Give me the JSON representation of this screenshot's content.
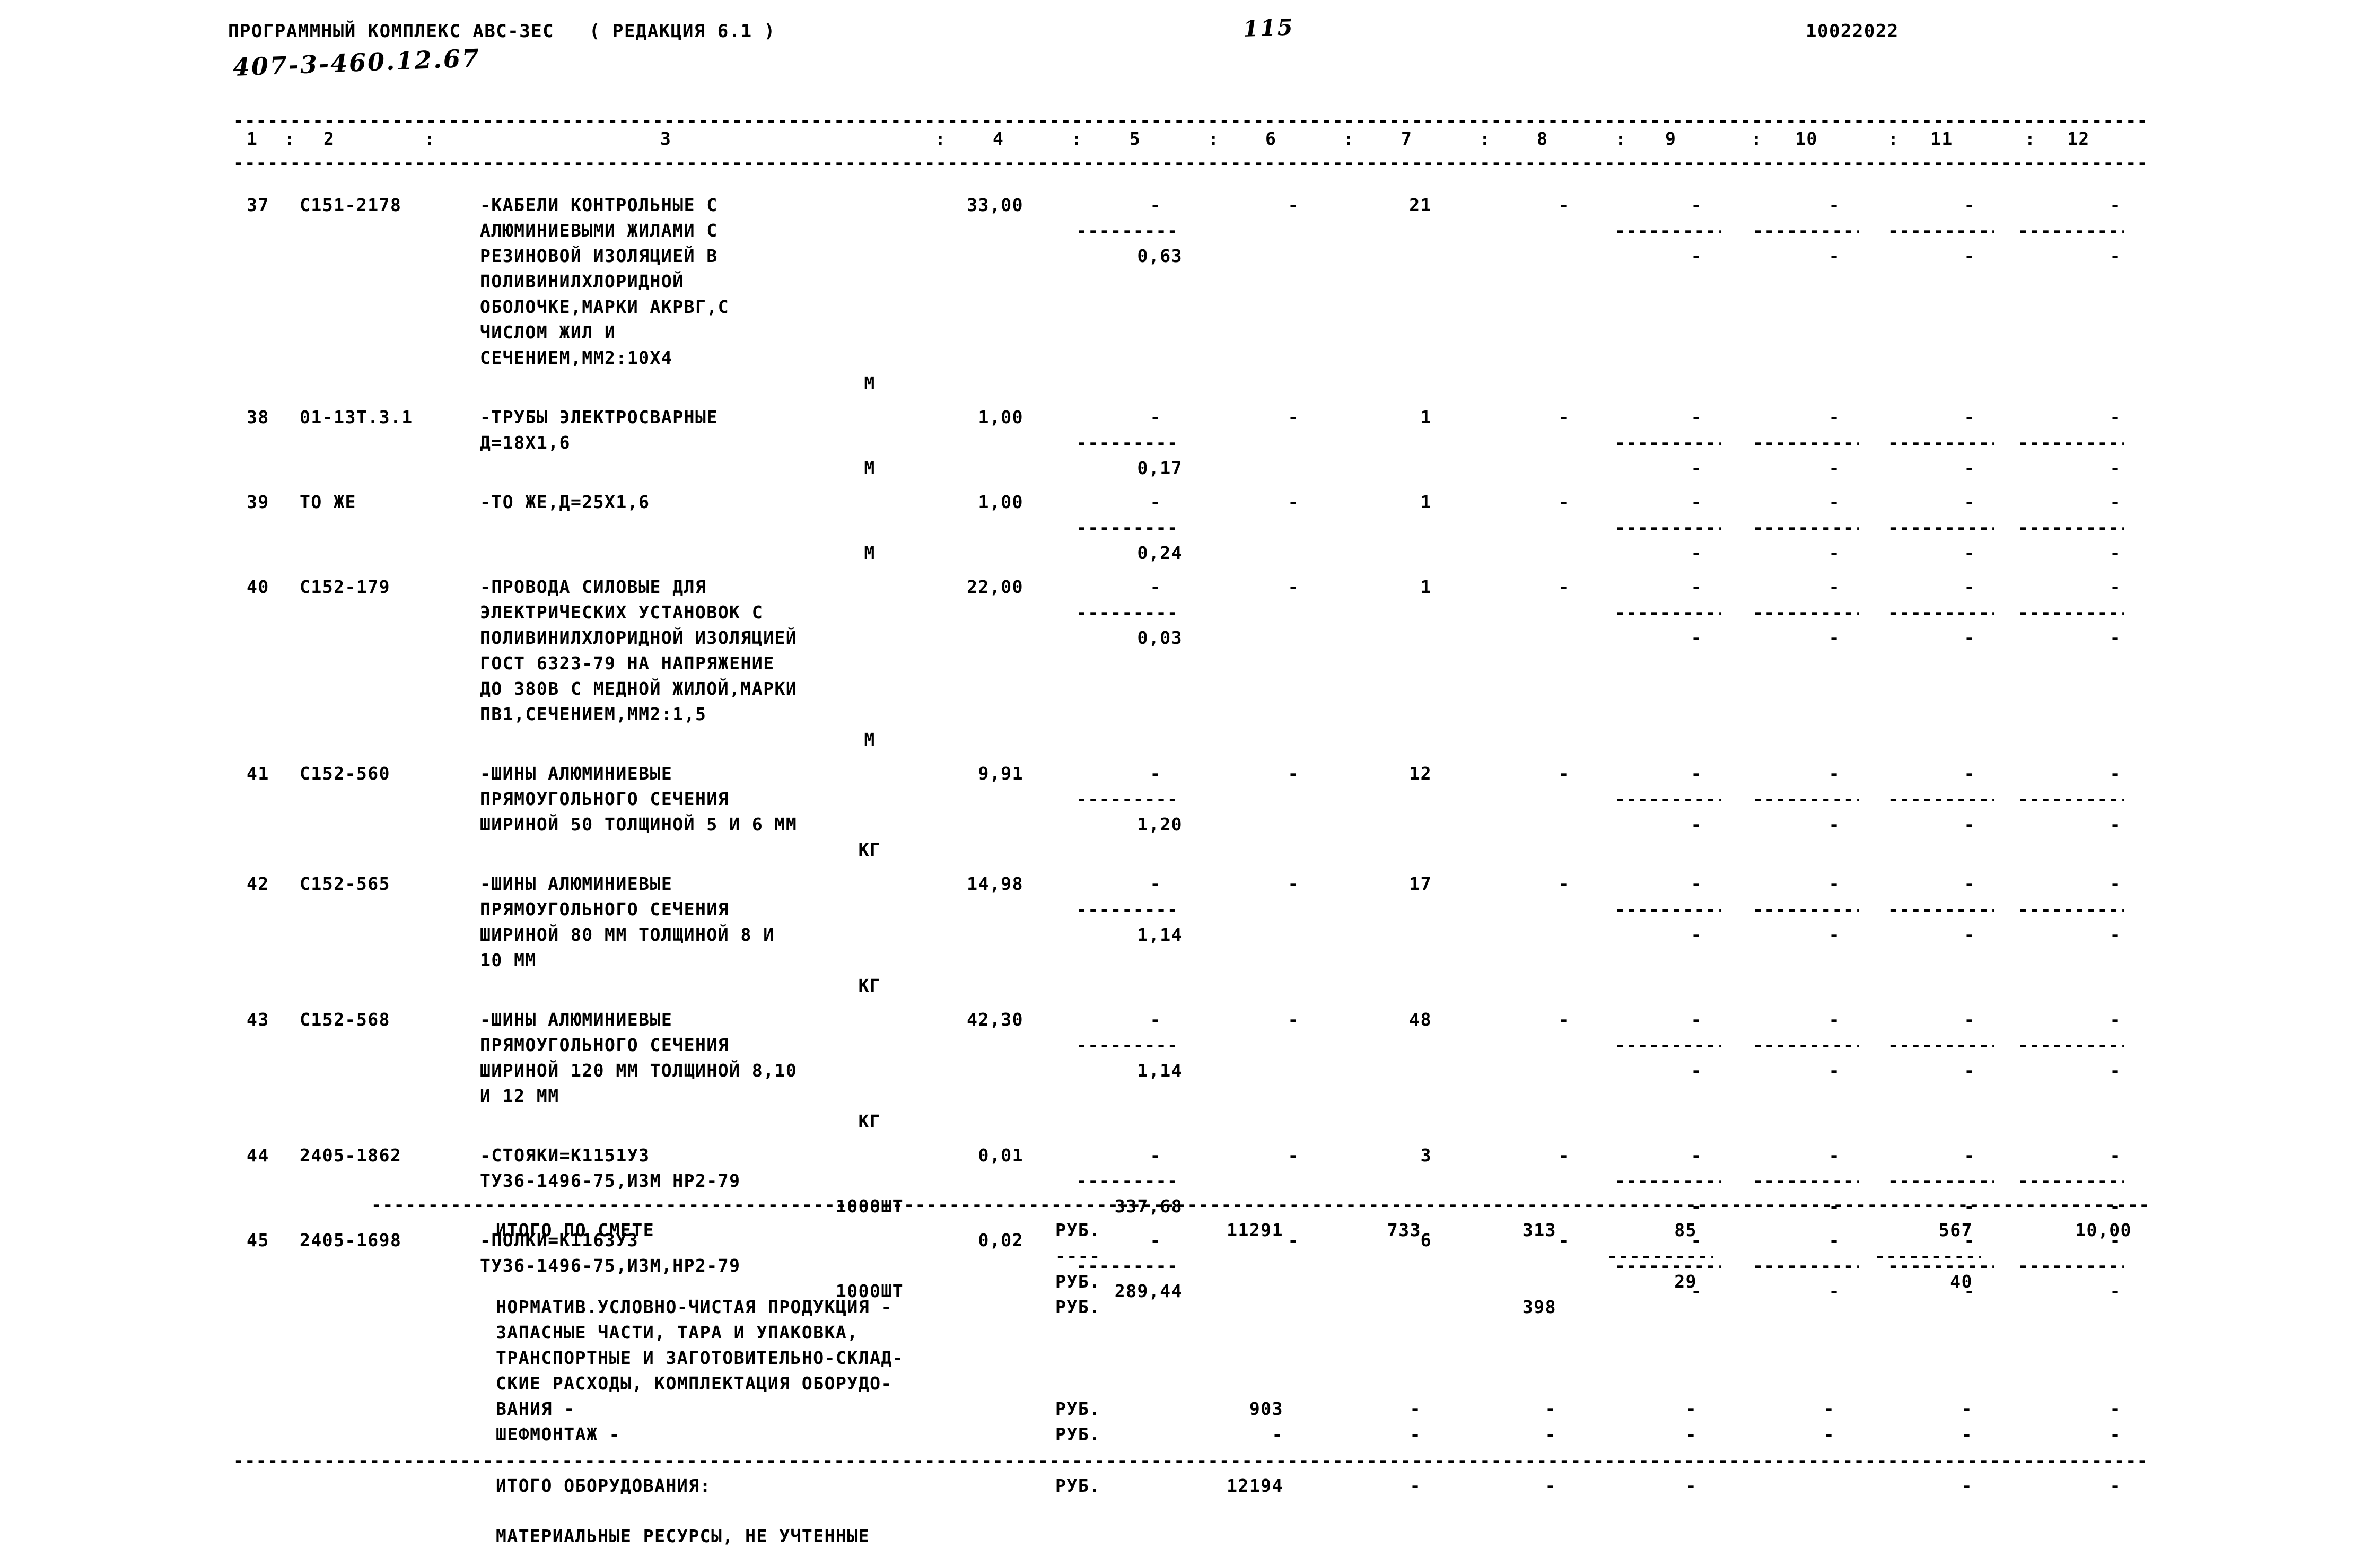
{
  "header": {
    "program_title": "ПРОГРАММНЫЙ КОМПЛЕКС АВС-ЗЕС   ( РЕДАКЦИЯ 6.1 )",
    "document_number": "407-3-460.12.67",
    "page_number": "115",
    "run_code": "10022022"
  },
  "table": {
    "column_headers": [
      "1",
      "2",
      "3",
      "4",
      "5",
      "6",
      "7",
      "8",
      "9",
      "10",
      "11",
      "12"
    ],
    "header_separator": ":",
    "dash_fill": "----",
    "rule_char": "-",
    "rows": [
      {
        "no": "37",
        "code": "С151-2178",
        "desc": [
          "-КАБЕЛИ КОНТРОЛЬНЫЕ С",
          "АЛЮМИНИЕВЫМИ ЖИЛАМИ С",
          "РЕЗИНОВОЙ ИЗОЛЯЦИЕЙ В",
          "ПОЛИВИНИЛХЛОРИДНОЙ",
          "ОБОЛОЧКЕ,МАРКИ АКРВГ,С",
          "ЧИСЛОМ ЖИЛ И",
          "СЕЧЕНИЕМ,ММ2:10Х4"
        ],
        "unit": "М",
        "qty": "33,00",
        "c5": "-",
        "c6": "-",
        "c7": "21",
        "c8": "-",
        "c9": "-",
        "c10": "-",
        "c11": "-",
        "c12": "-",
        "sub_value": "0,63",
        "sub_c9": "-",
        "sub_c10": "-",
        "sub_c11": "-",
        "sub_c12": "-"
      },
      {
        "no": "38",
        "code": "01-13Т.3.1",
        "desc": [
          "-ТРУБЫ ЭЛЕКТРОСВАРНЫЕ",
          "Д=18Х1,6"
        ],
        "unit": "М",
        "qty": "1,00",
        "c5": "-",
        "c6": "-",
        "c7": "1",
        "c8": "-",
        "c9": "-",
        "c10": "-",
        "c11": "-",
        "c12": "-",
        "sub_value": "0,17",
        "sub_c9": "-",
        "sub_c10": "-",
        "sub_c11": "-",
        "sub_c12": "-"
      },
      {
        "no": "39",
        "code": "ТО ЖЕ",
        "desc": [
          "-ТО ЖЕ,Д=25Х1,6"
        ],
        "unit": "М",
        "qty": "1,00",
        "c5": "-",
        "c6": "-",
        "c7": "1",
        "c8": "-",
        "c9": "-",
        "c10": "-",
        "c11": "-",
        "c12": "-",
        "sub_value": "0,24",
        "sub_c9": "-",
        "sub_c10": "-",
        "sub_c11": "-",
        "sub_c12": "-"
      },
      {
        "no": "40",
        "code": "С152-179",
        "desc": [
          "-ПРОВОДА СИЛОВЫЕ ДЛЯ",
          "ЭЛЕКТРИЧЕСКИХ УСТАНОВОК С",
          "ПОЛИВИНИЛХЛОРИДНОЙ ИЗОЛЯЦИЕЙ",
          "ГОСТ 6323-79 НА НАПРЯЖЕНИЕ",
          "ДО 380В С МЕДНОЙ ЖИЛОЙ,МАРКИ",
          "ПВ1,СЕЧЕНИЕМ,ММ2:1,5"
        ],
        "unit": "М",
        "qty": "22,00",
        "c5": "-",
        "c6": "-",
        "c7": "1",
        "c8": "-",
        "c9": "-",
        "c10": "-",
        "c11": "-",
        "c12": "-",
        "sub_value": "0,03",
        "sub_c9": "-",
        "sub_c10": "-",
        "sub_c11": "-",
        "sub_c12": "-"
      },
      {
        "no": "41",
        "code": "С152-560",
        "desc": [
          "-ШИНЫ АЛЮМИНИЕВЫЕ",
          "ПРЯМОУГОЛЬНОГО СЕЧЕНИЯ",
          "ШИРИНОЙ 50 ТОЛЩИНОЙ 5 И 6 ММ"
        ],
        "unit": "КГ",
        "qty": "9,91",
        "c5": "-",
        "c6": "-",
        "c7": "12",
        "c8": "-",
        "c9": "-",
        "c10": "-",
        "c11": "-",
        "c12": "-",
        "sub_value": "1,20",
        "sub_c9": "-",
        "sub_c10": "-",
        "sub_c11": "-",
        "sub_c12": "-"
      },
      {
        "no": "42",
        "code": "С152-565",
        "desc": [
          "-ШИНЫ АЛЮМИНИЕВЫЕ",
          "ПРЯМОУГОЛЬНОГО СЕЧЕНИЯ",
          "ШИРИНОЙ 80 ММ ТОЛЩИНОЙ 8 И",
          "10 ММ"
        ],
        "unit": "КГ",
        "qty": "14,98",
        "c5": "-",
        "c6": "-",
        "c7": "17",
        "c8": "-",
        "c9": "-",
        "c10": "-",
        "c11": "-",
        "c12": "-",
        "sub_value": "1,14",
        "sub_c9": "-",
        "sub_c10": "-",
        "sub_c11": "-",
        "sub_c12": "-"
      },
      {
        "no": "43",
        "code": "С152-568",
        "desc": [
          "-ШИНЫ АЛЮМИНИЕВЫЕ",
          "ПРЯМОУГОЛЬНОГО СЕЧЕНИЯ",
          "ШИРИНОЙ 120 ММ ТОЛЩИНОЙ 8,10",
          "И 12 ММ"
        ],
        "unit": "КГ",
        "qty": "42,30",
        "c5": "-",
        "c6": "-",
        "c7": "48",
        "c8": "-",
        "c9": "-",
        "c10": "-",
        "c11": "-",
        "c12": "-",
        "sub_value": "1,14",
        "sub_c9": "-",
        "sub_c10": "-",
        "sub_c11": "-",
        "sub_c12": "-"
      },
      {
        "no": "44",
        "code": "2405-1862",
        "desc": [
          "-СТОЯКИ=К1151У3",
          "ТУ36-1496-75,ИЗМ НР2-79"
        ],
        "unit": "1000ШТ",
        "qty": "0,01",
        "c5": "-",
        "c6": "-",
        "c7": "3",
        "c8": "-",
        "c9": "-",
        "c10": "-",
        "c11": "-",
        "c12": "-",
        "sub_value": "337,68",
        "sub_c9": "-",
        "sub_c10": "-",
        "sub_c11": "-",
        "sub_c12": "-"
      },
      {
        "no": "45",
        "code": "2405-1698",
        "desc": [
          "-ПОЛКИ=К1163У3",
          "ТУ36-1496-75,ИЗМ,НР2-79"
        ],
        "unit": "1000ШТ",
        "qty": "0,02",
        "c5": "-",
        "c6": "-",
        "c7": "6",
        "c8": "-",
        "c9": "-",
        "c10": "-",
        "c11": "-",
        "c12": "-",
        "sub_value": "289,44",
        "sub_c9": "-",
        "sub_c10": "-",
        "sub_c11": "-",
        "sub_c12": "-"
      }
    ]
  },
  "totals": {
    "itogo_label": "ИТОГО ПО СМЕТЕ",
    "itogo_unit": "РУБ.",
    "itogo_c6": "11291",
    "itogo_c7": "733",
    "itogo_c8": "313",
    "itogo_c9": "85",
    "itogo_c11": "567",
    "itogo_c12": "10,00",
    "unit2": "РУБ.",
    "sub_c9": "29",
    "sub_c11": "40",
    "normativ_label": "НОРМАТИВ.УСЛОВНО-ЧИСТАЯ ПРОДУКЦИЯ -",
    "normativ_unit": "РУБ.",
    "normativ_c8": "398",
    "extra_lines": [
      "ЗАПАСНЫЕ ЧАСТИ, ТАРА И УПАКОВКА,",
      "ТРАНСПОРТНЫЕ И ЗАГОТОВИТЕЛЬНО-СКЛАД-",
      "СКИЕ РАСХОДЫ, КОМПЛЕКТАЦИЯ ОБОРУДО-"
    ],
    "vania_label": "ВАНИЯ -",
    "vania_unit": "РУБ.",
    "vania_c6": "903",
    "vania_c7": "-",
    "vania_c8": "-",
    "vania_c9": "-",
    "vania_c10": "-",
    "vania_c11": "-",
    "vania_c12": "-",
    "shef_label": "ШЕФМОНТАЖ -",
    "shef_unit": "РУБ.",
    "shef_c6": "-",
    "shef_c7": "-",
    "shef_c8": "-",
    "shef_c9": "-",
    "shef_c10": "-",
    "shef_c11": "-",
    "shef_c12": "-",
    "equip_label": "ИТОГО ОБОРУДОВАНИЯ:",
    "equip_unit": "РУБ.",
    "equip_c6": "12194",
    "equip_c7": "-",
    "equip_c8": "-",
    "equip_c9": "-",
    "equip_c11": "-",
    "equip_c12": "-",
    "footer_note": "МАТЕРИАЛЬНЫЕ РЕСУРСЫ, НЕ УЧТЕННЫЕ"
  }
}
